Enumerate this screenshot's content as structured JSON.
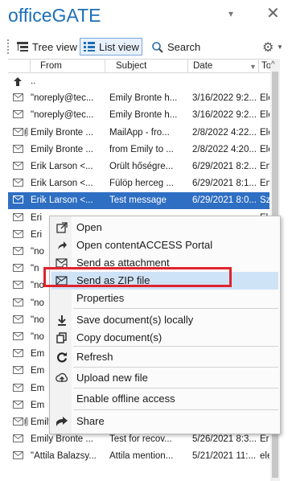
{
  "app": {
    "title": "officeGATE",
    "dropdown": "▾",
    "close": "✕"
  },
  "toolbar": {
    "tree_view": "Tree view",
    "list_view": "List view",
    "search": "Search"
  },
  "columns": {
    "from": "From",
    "subject": "Subject",
    "date": "Date",
    "to": "To"
  },
  "rows": [
    {
      "type": "parent",
      "from": "..",
      "subject": "",
      "date": "",
      "to": ""
    },
    {
      "type": "mail",
      "clip": false,
      "from": "\"noreply@tec...",
      "subject": "Emily Bronte h...",
      "date": "3/16/2022 9:2...",
      "to": "Elen"
    },
    {
      "type": "mail",
      "clip": false,
      "from": "\"noreply@tec...",
      "subject": "Emily Bronte h...",
      "date": "3/16/2022 9:2...",
      "to": "Elen"
    },
    {
      "type": "mail",
      "clip": true,
      "from": "Emily Bronte ...",
      "subject": "MailApp - fro...",
      "date": "2/8/2022 4:22...",
      "to": "Elen"
    },
    {
      "type": "mail",
      "clip": false,
      "from": "Emily Bronte ...",
      "subject": "from Emily to ...",
      "date": "2/8/2022 4:20...",
      "to": "Elen"
    },
    {
      "type": "mail",
      "clip": false,
      "from": "Erik Larson <...",
      "subject": "Őrült hőségre...",
      "date": "6/29/2021 8:2...",
      "to": "Emil"
    },
    {
      "type": "mail",
      "clip": false,
      "from": "Erik Larson <...",
      "subject": "Fülöp herceg ...",
      "date": "6/29/2021 8:1...",
      "to": "Emil"
    },
    {
      "type": "mail",
      "clip": false,
      "selected": true,
      "from": "Erik Larson <...",
      "subject": "Test message",
      "date": "6/29/2021 8:0...",
      "to": "Szilv"
    },
    {
      "type": "mail",
      "clip": false,
      "from": "Eri",
      "subject": "",
      "date": "",
      "to": "Elen"
    },
    {
      "type": "mail",
      "clip": false,
      "from": "Eri",
      "subject": "",
      "date": "",
      "to": "Emil"
    },
    {
      "type": "mail",
      "clip": false,
      "from": "\"no",
      "subject": "",
      "date": "",
      "to": "Elen"
    },
    {
      "type": "mail",
      "clip": false,
      "from": "\"n",
      "subject": "",
      "date": "",
      "to": "Elen"
    },
    {
      "type": "mail",
      "clip": false,
      "from": "\"no",
      "subject": "",
      "date": "",
      "to": "Elen"
    },
    {
      "type": "mail",
      "clip": false,
      "from": "\"no",
      "subject": "",
      "date": "",
      "to": "Elen"
    },
    {
      "type": "mail",
      "clip": false,
      "from": "\"no",
      "subject": "",
      "date": "",
      "to": "Elen"
    },
    {
      "type": "mail",
      "clip": false,
      "from": "\"no",
      "subject": "",
      "date": "",
      "to": "Elen"
    },
    {
      "type": "mail",
      "clip": false,
      "from": "Em",
      "subject": "",
      "date": "",
      "to": "Erik"
    },
    {
      "type": "mail",
      "clip": false,
      "from": "Em",
      "subject": "",
      "date": "",
      "to": "Elen"
    },
    {
      "type": "mail",
      "clip": false,
      "from": "Em",
      "subject": "",
      "date": "",
      "to": "Szilv"
    },
    {
      "type": "mail",
      "clip": false,
      "from": "Em",
      "subject": "",
      "date": "",
      "to": "Szilv"
    },
    {
      "type": "mail",
      "clip": true,
      "from": "Emily Bronte ...",
      "subject": "Test for recov...",
      "date": "5/26/2021 8:3...",
      "to": "Elen"
    },
    {
      "type": "mail",
      "clip": false,
      "from": "Emily Bronte ...",
      "subject": "Test for recov...",
      "date": "5/26/2021 8:3...",
      "to": "Erik"
    },
    {
      "type": "mail",
      "clip": false,
      "from": "\"Attila Balazsy...",
      "subject": "Attila mention...",
      "date": "5/21/2021 11:...",
      "to": "elen"
    }
  ],
  "context_menu": {
    "items": [
      {
        "label": "Open",
        "icon": "open-external-icon"
      },
      {
        "label": "Open contentACCESS Portal",
        "icon": "share-arrow-icon"
      },
      {
        "label": "Send as attachment",
        "icon": "envelope-attach-icon"
      },
      {
        "label": "Send as ZIP file",
        "icon": "envelope-icon",
        "highlighted": true
      },
      {
        "label": "Properties",
        "icon": ""
      },
      {
        "label": "Save document(s) locally",
        "icon": "download-icon"
      },
      {
        "label": "Copy document(s)",
        "icon": "copy-icon"
      },
      {
        "label": "Refresh",
        "icon": "refresh-icon"
      },
      {
        "label": "Upload new file",
        "icon": "upload-icon"
      },
      {
        "label": "Enable offline access",
        "icon": ""
      },
      {
        "label": "Share",
        "icon": "share-icon"
      }
    ]
  },
  "colors": {
    "accent": "#1d6fb8",
    "selection": "#2f6fc3",
    "menu_highlight": "#cfe3f7",
    "annotation": "#e0232e"
  }
}
